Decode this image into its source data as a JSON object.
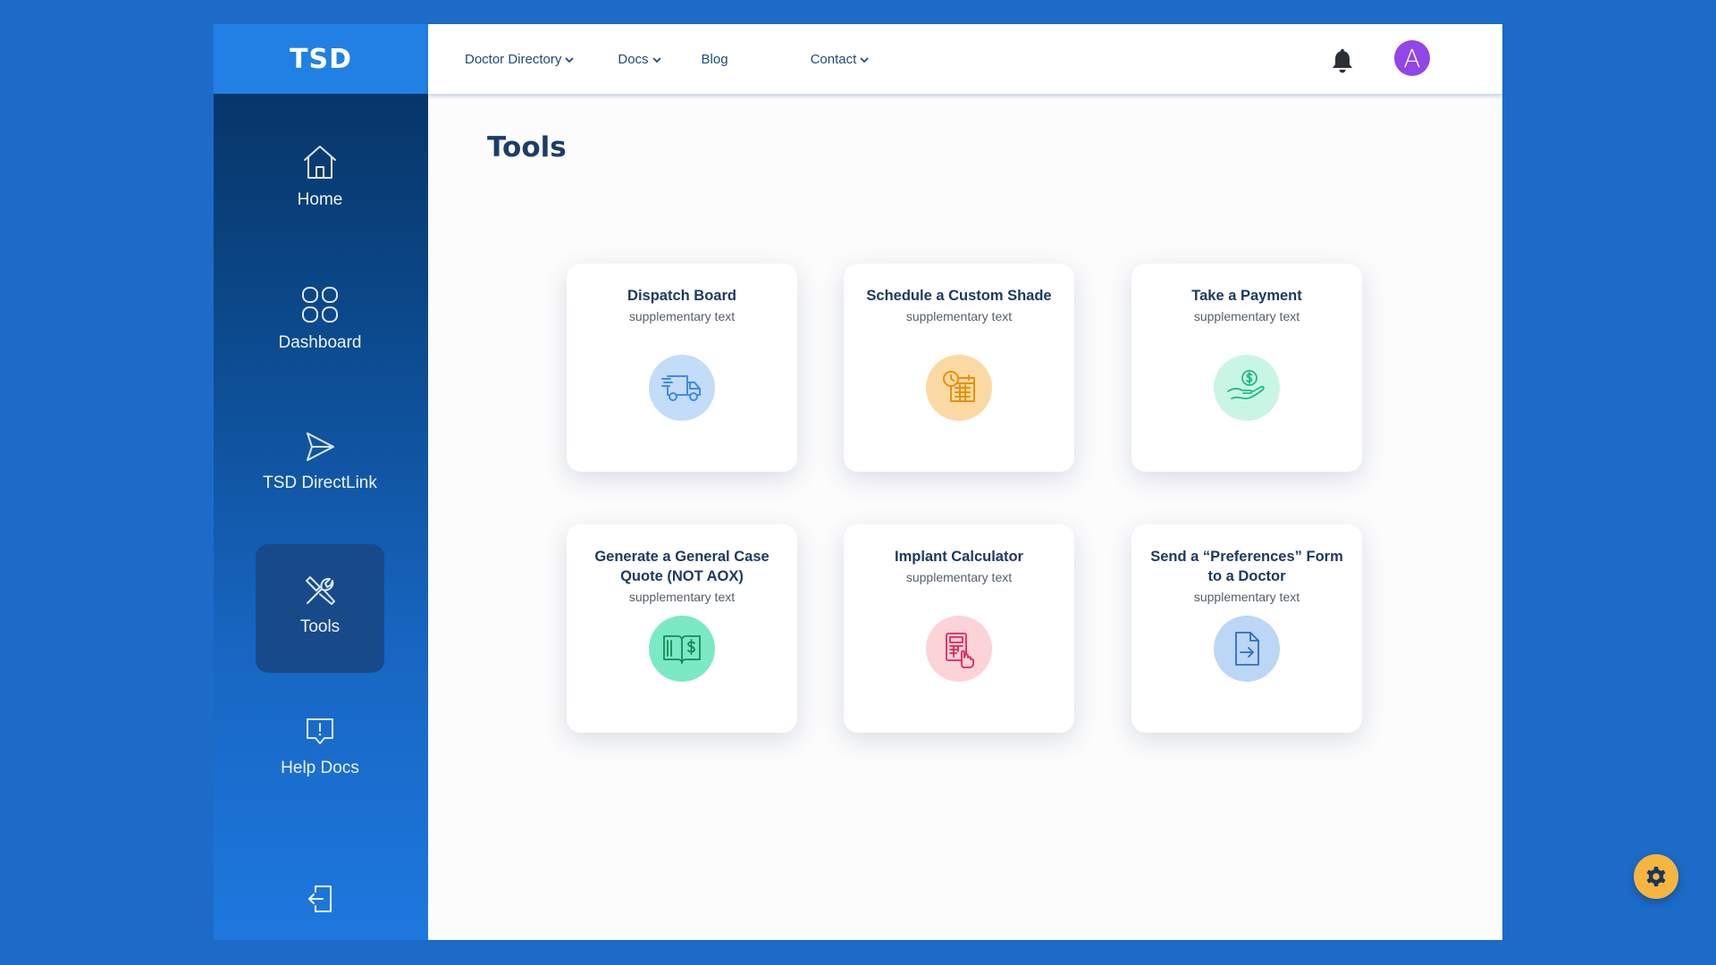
{
  "sidebar": {
    "logo": "TSD",
    "items": [
      {
        "label": "Home",
        "icon": "home-icon"
      },
      {
        "label": "Dashboard",
        "icon": "grid-icon"
      },
      {
        "label": "TSD DirectLink",
        "icon": "send-icon"
      },
      {
        "label": "Tools",
        "icon": "tools-icon",
        "active": true
      },
      {
        "label": "Help Docs",
        "icon": "help-chat-icon"
      }
    ],
    "logout_icon": "logout-icon"
  },
  "topbar": {
    "menu": [
      {
        "label": "Doctor Directory",
        "dropdown": true
      },
      {
        "label": "Docs",
        "dropdown": true
      },
      {
        "label": "Blog",
        "dropdown": false
      },
      {
        "label": "Contact",
        "dropdown": true
      }
    ],
    "notification_icon": "bell-icon",
    "avatar_letter": "A"
  },
  "page": {
    "title": "Tools"
  },
  "cards": [
    {
      "title": "Dispatch Board",
      "subtitle": "supplementary text",
      "icon": "truck-icon",
      "color": "#c3dcf7"
    },
    {
      "title": "Schedule a Custom Shade",
      "subtitle": "supplementary text",
      "icon": "calendar-clock-icon",
      "color": "#fbd9a2"
    },
    {
      "title": "Take a Payment",
      "subtitle": "supplementary text",
      "icon": "hand-coin-icon",
      "color": "#c9f5e5"
    },
    {
      "title": "Generate a General Case Quote (NOT AOX)",
      "subtitle": "supplementary text",
      "icon": "money-book-icon",
      "color": "#7be9c4"
    },
    {
      "title": "Implant Calculator",
      "subtitle": "supplementary text",
      "icon": "calculator-icon",
      "color": "#fcd3d7"
    },
    {
      "title": "Send a “Preferences” Form to a Doctor",
      "subtitle": "supplementary text",
      "icon": "file-send-icon",
      "color": "#bcd6f6"
    }
  ],
  "settings_icon": "gear-icon",
  "colors": {
    "background": "#1d6bc8",
    "accent": "#2180e4",
    "avatar": "#9245e8",
    "fab": "#f6b53f"
  }
}
